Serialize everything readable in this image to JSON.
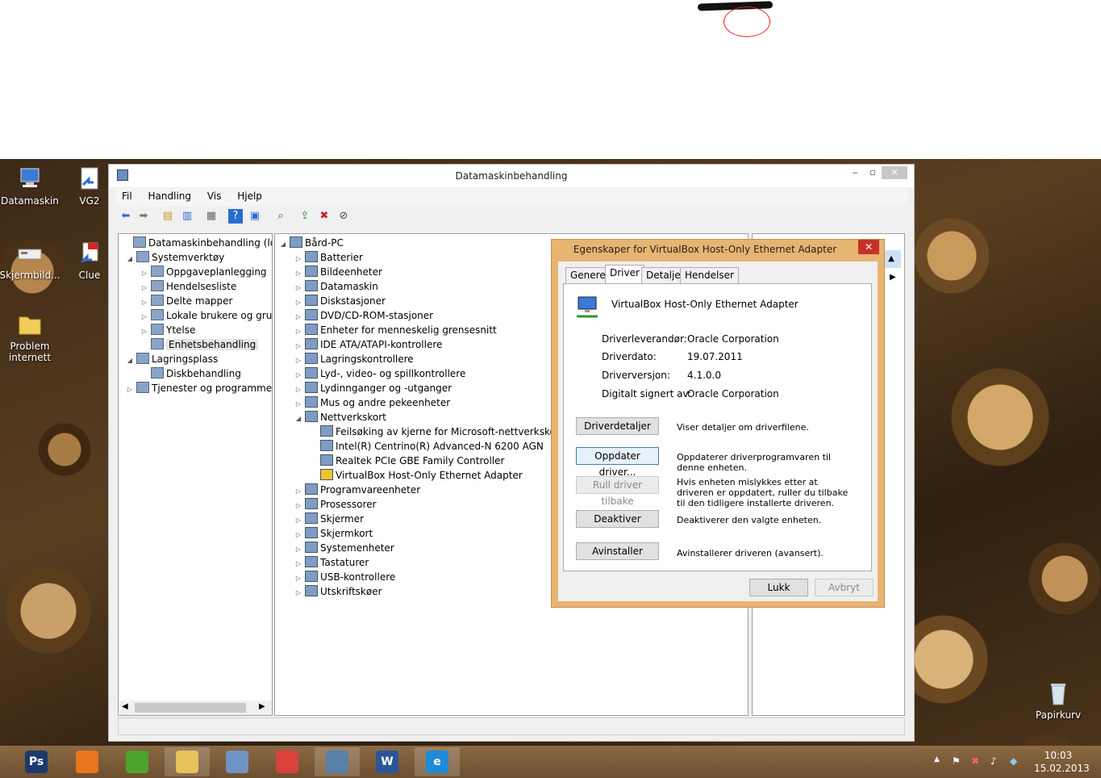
{
  "main_window": {
    "title": "Datamaskinbehandling",
    "menu": [
      "Fil",
      "Handling",
      "Vis",
      "Hjelp"
    ]
  },
  "left_tree": [
    {
      "label": "Datamaskinbehandling (lokal)",
      "level": 0,
      "arrow": "",
      "icon": "computer-management-icon"
    },
    {
      "label": "Systemverktøy",
      "level": 1,
      "arrow": "◢",
      "icon": "tools-icon"
    },
    {
      "label": "Oppgaveplanlegging",
      "level": 2,
      "arrow": "▷",
      "icon": "clock-icon"
    },
    {
      "label": "Hendelsesliste",
      "level": 2,
      "arrow": "▷",
      "icon": "event-log-icon"
    },
    {
      "label": "Delte mapper",
      "level": 2,
      "arrow": "▷",
      "icon": "shared-folder-icon"
    },
    {
      "label": "Lokale brukere og grupper",
      "level": 2,
      "arrow": "▷",
      "icon": "users-icon"
    },
    {
      "label": "Ytelse",
      "level": 2,
      "arrow": "▷",
      "icon": "performance-icon"
    },
    {
      "label": "Enhetsbehandling",
      "level": 2,
      "arrow": "",
      "icon": "device-manager-icon",
      "selected": true
    },
    {
      "label": "Lagringsplass",
      "level": 1,
      "arrow": "◢",
      "icon": "storage-icon"
    },
    {
      "label": "Diskbehandling",
      "level": 2,
      "arrow": "",
      "icon": "disk-icon"
    },
    {
      "label": "Tjenester og programmer",
      "level": 1,
      "arrow": "▷",
      "icon": "services-icon"
    }
  ],
  "device_tree": [
    {
      "label": "Bård-PC",
      "level": 0,
      "arrow": "◢",
      "icon": "computer-icon"
    },
    {
      "label": "Batterier",
      "level": 1,
      "arrow": "▷",
      "icon": "battery-icon"
    },
    {
      "label": "Bildeenheter",
      "level": 1,
      "arrow": "▷",
      "icon": "camera-icon"
    },
    {
      "label": "Datamaskin",
      "level": 1,
      "arrow": "▷",
      "icon": "monitor-icon"
    },
    {
      "label": "Diskstasjoner",
      "level": 1,
      "arrow": "▷",
      "icon": "disk-drive-icon"
    },
    {
      "label": "DVD/CD-ROM-stasjoner",
      "level": 1,
      "arrow": "▷",
      "icon": "dvd-icon"
    },
    {
      "label": "Enheter for menneskelig grensesnitt",
      "level": 1,
      "arrow": "▷",
      "icon": "hid-icon"
    },
    {
      "label": "IDE ATA/ATAPI-kontrollere",
      "level": 1,
      "arrow": "▷",
      "icon": "ide-icon"
    },
    {
      "label": "Lagringskontrollere",
      "level": 1,
      "arrow": "▷",
      "icon": "storage-controller-icon"
    },
    {
      "label": "Lyd-, video- og spillkontrollere",
      "level": 1,
      "arrow": "▷",
      "icon": "speaker-icon"
    },
    {
      "label": "Lydinnganger og -utganger",
      "level": 1,
      "arrow": "▷",
      "icon": "speaker-icon"
    },
    {
      "label": "Mus og andre pekeenheter",
      "level": 1,
      "arrow": "▷",
      "icon": "mouse-icon"
    },
    {
      "label": "Nettverkskort",
      "level": 1,
      "arrow": "◢",
      "icon": "network-icon"
    },
    {
      "label": "Feilsøking av kjerne for Microsoft-nettverkskort",
      "level": 2,
      "arrow": "",
      "icon": "network-adapter-icon"
    },
    {
      "label": "Intel(R) Centrino(R) Advanced-N 6200 AGN",
      "level": 2,
      "arrow": "",
      "icon": "network-adapter-icon"
    },
    {
      "label": "Realtek PCIe GBE Family Controller",
      "level": 2,
      "arrow": "",
      "icon": "network-adapter-icon"
    },
    {
      "label": "VirtualBox Host-Only Ethernet Adapter",
      "level": 2,
      "arrow": "",
      "icon": "network-adapter-warning-icon"
    },
    {
      "label": "Programvareenheter",
      "level": 1,
      "arrow": "▷",
      "icon": "software-device-icon"
    },
    {
      "label": "Prosessorer",
      "level": 1,
      "arrow": "▷",
      "icon": "processor-icon"
    },
    {
      "label": "Skjermer",
      "level": 1,
      "arrow": "▷",
      "icon": "monitor-icon"
    },
    {
      "label": "Skjermkort",
      "level": 1,
      "arrow": "▷",
      "icon": "display-adapter-icon"
    },
    {
      "label": "Systemenheter",
      "level": 1,
      "arrow": "▷",
      "icon": "system-device-icon"
    },
    {
      "label": "Tastaturer",
      "level": 1,
      "arrow": "▷",
      "icon": "keyboard-icon"
    },
    {
      "label": "USB-kontrollere",
      "level": 1,
      "arrow": "▷",
      "icon": "usb-icon"
    },
    {
      "label": "Utskriftskøer",
      "level": 1,
      "arrow": "▷",
      "icon": "printer-icon"
    }
  ],
  "dialog": {
    "title": "Egenskaper for VirtualBox Host-Only Ethernet Adapter",
    "tabs": [
      "Generelt",
      "Driver",
      "Detaljer",
      "Hendelser"
    ],
    "active_tab": "Driver",
    "device_name": "VirtualBox Host-Only Ethernet Adapter",
    "fields": [
      {
        "label": "Driverleverandør:",
        "value": "Oracle Corporation"
      },
      {
        "label": "Driverdato:",
        "value": "19.07.2011"
      },
      {
        "label": "Driverversjon:",
        "value": "4.1.0.0"
      },
      {
        "label": "Digitalt signert av:",
        "value": "Oracle Corporation"
      }
    ],
    "actions": [
      {
        "button": "Driverdetaljer",
        "desc": "Viser detaljer om driverfilene.",
        "state": "normal"
      },
      {
        "button": "Oppdater driver...",
        "desc": "Oppdaterer driverprogramvaren til denne enheten.",
        "state": "focus"
      },
      {
        "button": "Rull driver tilbake",
        "desc": "Hvis enheten mislykkes etter at driveren er oppdatert, ruller du tilbake til den tidligere installerte driveren.",
        "state": "disabled"
      },
      {
        "button": "Deaktiver",
        "desc": "Deaktiverer den valgte enheten.",
        "state": "normal"
      },
      {
        "button": "Avinstaller",
        "desc": "Avinstallerer driveren (avansert).",
        "state": "normal"
      }
    ],
    "ok_label": "Lukk",
    "cancel_label": "Avbryt"
  },
  "desktop_icons": [
    {
      "label": "Datamaskin",
      "icon": "computer-icon"
    },
    {
      "label": "VG2",
      "icon": "shortcut-icon"
    },
    {
      "label": "Skjermbild...",
      "icon": "screenshot-icon"
    },
    {
      "label": "Clue",
      "icon": "shortcut-icon"
    },
    {
      "label": "Problem internett",
      "icon": "folder-icon"
    },
    {
      "label": "Papirkurv",
      "icon": "recycle-bin-icon"
    }
  ],
  "taskbar": {
    "apps": [
      {
        "label": "Ps",
        "icon": "photoshop-icon",
        "color": "#1b3a6b"
      },
      {
        "label": "",
        "icon": "firefox-icon",
        "color": "#e8761e"
      },
      {
        "label": "",
        "icon": "spotify-icon",
        "color": "#4ca32b"
      },
      {
        "label": "",
        "icon": "explorer-icon",
        "color": "#e8c25a"
      },
      {
        "label": "",
        "icon": "file-explorer-icon",
        "color": "#6f93c4"
      },
      {
        "label": "",
        "icon": "chrome-icon",
        "color": "#d9413a"
      },
      {
        "label": "",
        "icon": "computer-management-icon",
        "color": "#5a7fa8"
      },
      {
        "label": "W",
        "icon": "word-icon",
        "color": "#2a5699"
      },
      {
        "label": "e",
        "icon": "ie-icon",
        "color": "#1e8bd8"
      }
    ],
    "time": "10:03",
    "date": "15.02.2013"
  }
}
